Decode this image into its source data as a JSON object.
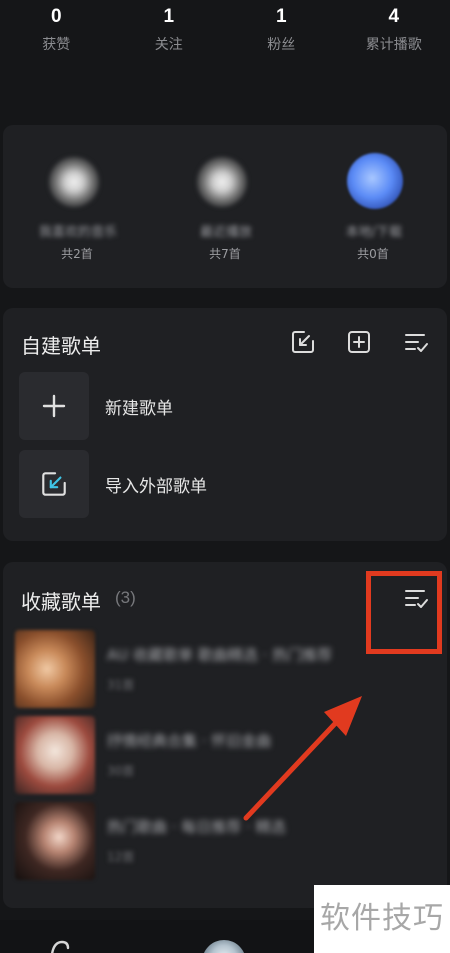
{
  "stats": [
    {
      "value": "0",
      "label": "获赞"
    },
    {
      "value": "1",
      "label": "关注"
    },
    {
      "value": "1",
      "label": "粉丝"
    },
    {
      "value": "4",
      "label": "累计播歌"
    }
  ],
  "recent": [
    {
      "name": "我喜欢的音乐",
      "count": "共2首"
    },
    {
      "name": "最近播放",
      "count": "共7首"
    },
    {
      "name": "本地/下载",
      "count": "共0首"
    }
  ],
  "created": {
    "title": "自建歌单",
    "items": [
      {
        "label": "新建歌单",
        "icon": "plus-icon"
      },
      {
        "label": "导入外部歌单",
        "icon": "import-icon"
      }
    ]
  },
  "favorites": {
    "title": "收藏歌单",
    "count": "(3)",
    "items": [
      {
        "name": "AU 收藏歌单 歌曲精选 · 热门推荐",
        "sub": "31首"
      },
      {
        "name": "抒情经典合集 · 怀旧金曲",
        "sub": "30首"
      },
      {
        "name": "热门歌曲 · 每日推荐 · 精选",
        "sub": "12首"
      }
    ]
  },
  "watermark": "软件技巧",
  "colors": {
    "accent": "#e13a1f",
    "background": "#151618",
    "card": "#1f2023"
  }
}
